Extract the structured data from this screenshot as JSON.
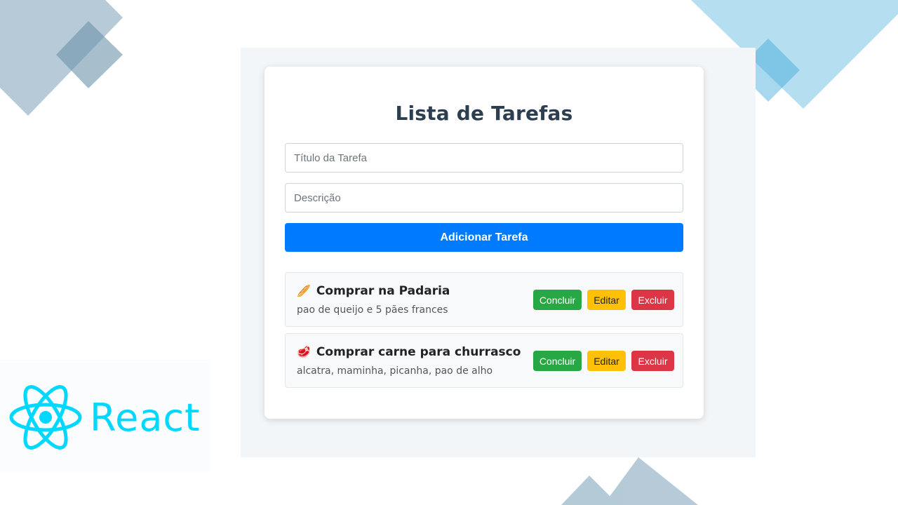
{
  "app": {
    "title": "Lista de Tarefas"
  },
  "form": {
    "title_placeholder": "Título da Tarefa",
    "title_value": "",
    "description_placeholder": "Descrição",
    "description_value": "",
    "add_label": "Adicionar Tarefa"
  },
  "tasks": [
    {
      "emoji": "🥖",
      "title": "Comprar na Padaria",
      "description": "pao de queijo e 5 pães frances",
      "complete_label": "Concluir",
      "edit_label": "Editar",
      "delete_label": "Excluir"
    },
    {
      "emoji": "🥩",
      "title": "Comprar carne para churrasco",
      "description": "alcatra, maminha, picanha, pao de alho",
      "complete_label": "Concluir",
      "edit_label": "Editar",
      "delete_label": "Excluir"
    }
  ],
  "branding": {
    "logo_text": "React",
    "logo_icon": "react-atom-icon"
  },
  "colors": {
    "primary": "#007bff",
    "success": "#28a745",
    "warning": "#ffc107",
    "danger": "#dc3545",
    "heading": "#2c3e50",
    "react": "#00d8ff"
  }
}
